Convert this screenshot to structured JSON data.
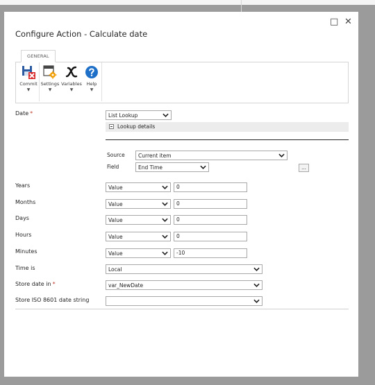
{
  "dialog": {
    "title": "Configure Action - Calculate date",
    "maximize_glyph": "□",
    "close_glyph": "✕"
  },
  "ribbon": {
    "tab": "GENERAL",
    "buttons": [
      {
        "label": "Commit",
        "icon": "commit-save-icon"
      },
      {
        "label": "Settings",
        "icon": "settings-gear-icon"
      },
      {
        "label": "Variables",
        "icon": "variables-x-icon"
      },
      {
        "label": "Help",
        "icon": "help-question-icon"
      }
    ],
    "dropdown_glyph": "▼"
  },
  "form": {
    "date": {
      "label": "Date",
      "required_mark": "*",
      "value": "List Lookup"
    },
    "lookup_details": {
      "label": "Lookup details"
    },
    "source": {
      "label": "Source",
      "value": "Current item"
    },
    "field": {
      "label": "Field",
      "value": "End Time",
      "browse_label": "..."
    },
    "years": {
      "label": "Years",
      "type": "Value",
      "value": "0"
    },
    "months": {
      "label": "Months",
      "type": "Value",
      "value": "0"
    },
    "days": {
      "label": "Days",
      "type": "Value",
      "value": "0"
    },
    "hours": {
      "label": "Hours",
      "type": "Value",
      "value": "0"
    },
    "minutes": {
      "label": "Minutes",
      "type": "Value",
      "value": "-10"
    },
    "time_is": {
      "label": "Time is",
      "value": "Local"
    },
    "store_date": {
      "label": "Store date in",
      "required_mark": "*",
      "value": "var_NewDate"
    },
    "store_iso": {
      "label": "Store ISO 8601 date string",
      "value": ""
    }
  }
}
